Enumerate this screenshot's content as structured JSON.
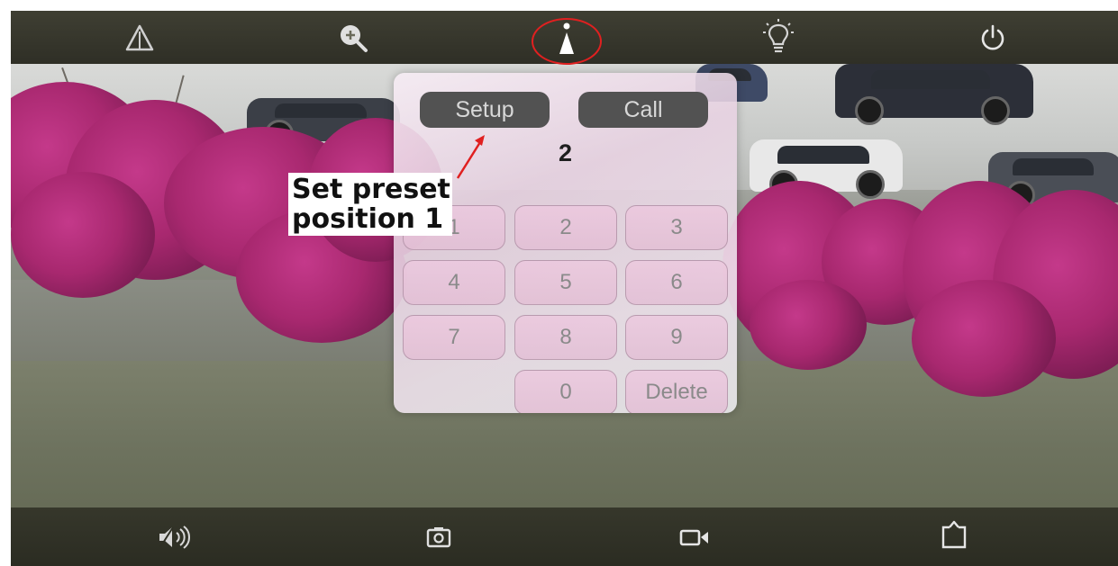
{
  "toolbar_top": {
    "icons": [
      "alert-triangle-icon",
      "zoom-in-icon",
      "preset-icon",
      "lightbulb-icon",
      "power-icon"
    ],
    "active": "preset-icon",
    "highlight_color": "#e02020"
  },
  "preset_panel": {
    "setup_label": "Setup",
    "call_label": "Call",
    "display_value": "2",
    "keys": {
      "k1": "1",
      "k2": "2",
      "k3": "3",
      "k4": "4",
      "k5": "5",
      "k6": "6",
      "k7": "7",
      "k8": "8",
      "k9": "9",
      "k0": "0",
      "delete": "Delete"
    }
  },
  "annotation": {
    "line1": "Set preset",
    "line2": "position 1",
    "arrow_color": "#e02020"
  },
  "toolbar_bottom": {
    "icons": [
      "speaker-icon",
      "snapshot-icon",
      "record-video-icon",
      "share-icon"
    ]
  }
}
